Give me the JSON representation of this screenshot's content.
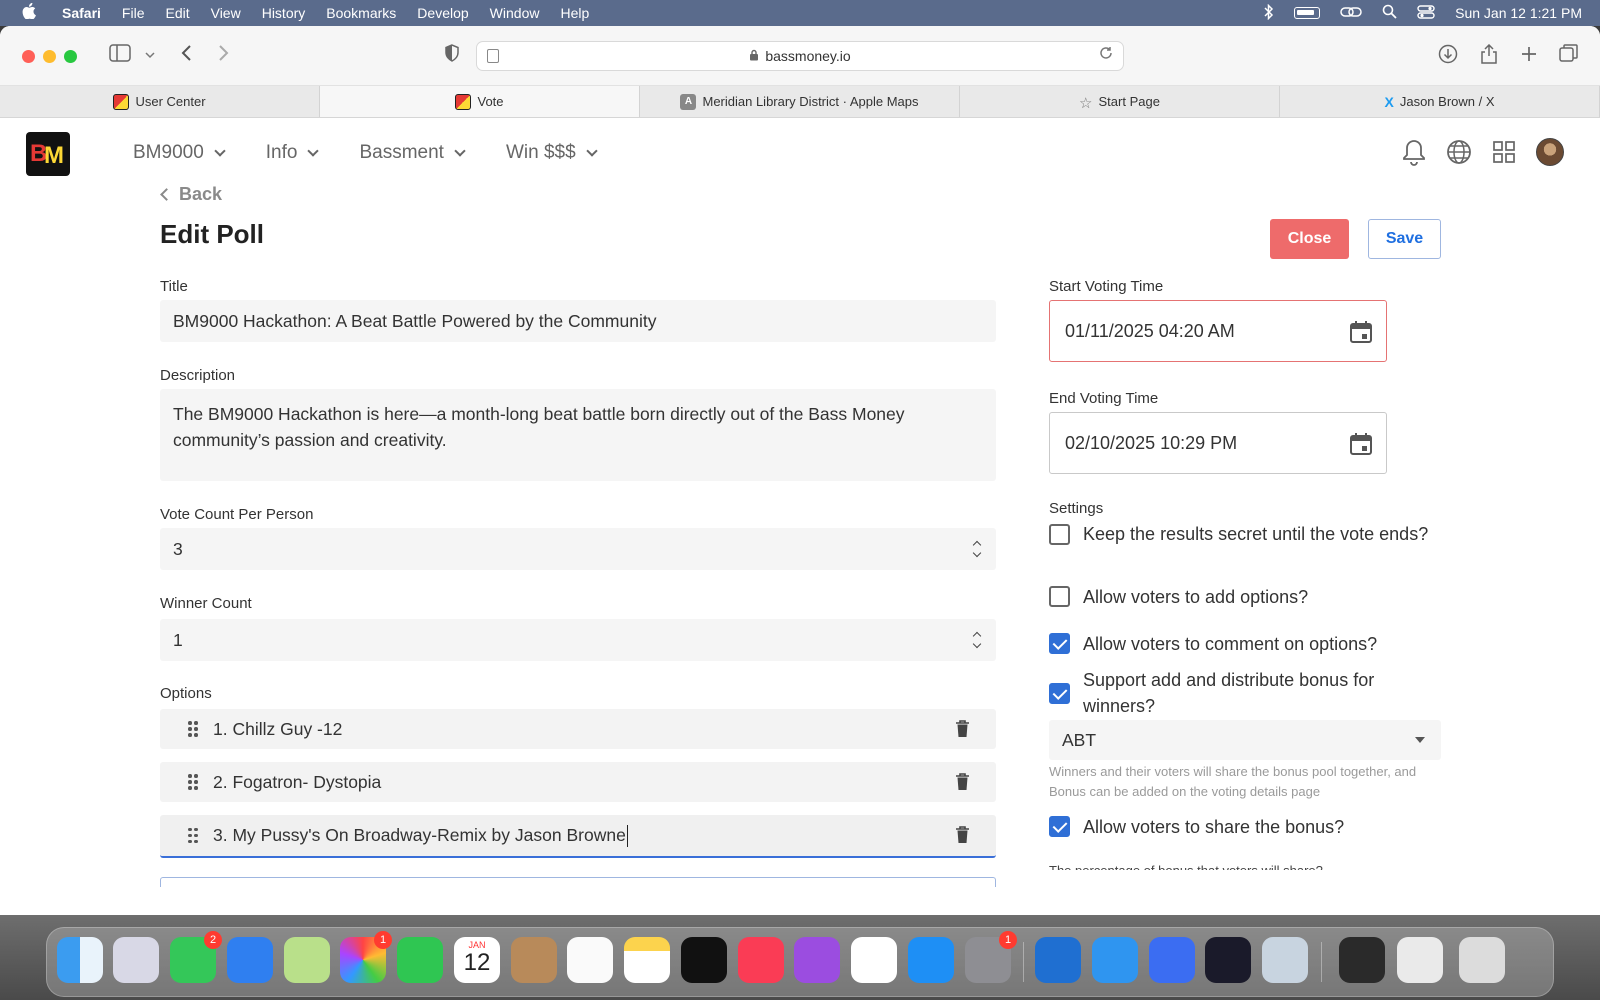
{
  "menubar": {
    "app": "Safari",
    "items": [
      "File",
      "Edit",
      "View",
      "History",
      "Bookmarks",
      "Develop",
      "Window",
      "Help"
    ],
    "datetime": "Sun Jan 12  1:21 PM"
  },
  "browser": {
    "url": "bassmoney.io",
    "tabs": [
      {
        "label": "User Center",
        "favicon": "bm-logo-icon"
      },
      {
        "label": "Vote",
        "favicon": "bm-logo-icon",
        "active": true
      },
      {
        "label": "Meridian Library District · Apple Maps",
        "favicon": "maps-icon"
      },
      {
        "label": "Start Page",
        "favicon": "star-icon"
      },
      {
        "label": "Jason Brown / X",
        "favicon": "x-icon"
      }
    ]
  },
  "site": {
    "logo_letters": {
      "b": "B",
      "m": "M"
    },
    "nav": [
      {
        "label": "BM9000"
      },
      {
        "label": "Info"
      },
      {
        "label": "Bassment"
      },
      {
        "label": "Win $$$"
      }
    ]
  },
  "page": {
    "back_label": "Back",
    "title": "Edit Poll",
    "close_label": "Close",
    "save_label": "Save"
  },
  "form": {
    "title_label": "Title",
    "title_value": "BM9000 Hackathon: A Beat Battle Powered by the Community",
    "description_label": "Description",
    "description_value": "The BM9000 Hackathon is here—a month-long beat battle born directly out of the Bass Money community’s passion and creativity.",
    "vote_count_label": "Vote Count Per Person",
    "vote_count_value": "3",
    "winner_count_label": "Winner Count",
    "winner_count_value": "1",
    "options_label": "Options",
    "options": [
      {
        "text": "1. Chillz Guy -12"
      },
      {
        "text": "2. Fogatron- Dystopia"
      },
      {
        "text": "3. My Pussy's On Broadway-Remix by Jason Browne"
      }
    ]
  },
  "settings": {
    "start_label": "Start Voting Time",
    "start_value": "01/11/2025 04:20 AM",
    "end_label": "End Voting Time",
    "end_value": "02/10/2025 10:29 PM",
    "settings_label": "Settings",
    "checks": [
      {
        "label": "Keep the results secret until the vote ends?",
        "checked": false
      },
      {
        "label": "Allow voters to add options?",
        "checked": false
      },
      {
        "label": "Allow voters to comment on options?",
        "checked": true
      },
      {
        "label": "Support add and distribute bonus for winners?",
        "checked": true
      }
    ],
    "token_value": "ABT",
    "bonus_hint": "Winners and their voters will share the bonus pool together, and Bonus can be added on the voting details page",
    "share_bonus_label": "Allow voters to share the bonus?",
    "share_bonus_checked": true,
    "cut_label": "The percentage of bonus that voters will share?"
  },
  "dock": {
    "badges": {
      "messages": "2",
      "photos": "1",
      "settings": "1"
    },
    "calendar": {
      "month": "JAN",
      "day": "12"
    }
  },
  "colors": {
    "accent": "#2f6fd6",
    "danger": "#ee6b6b",
    "menubar": "#5a6b8c"
  }
}
